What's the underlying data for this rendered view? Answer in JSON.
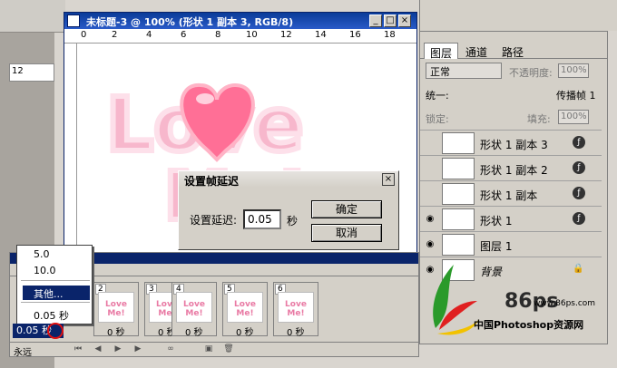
{
  "document": {
    "title": "未标题-3 @ 100% (形状 1 副本 3, RGB/8)",
    "ruler_ticks": [
      "0",
      "2",
      "4",
      "6",
      "8",
      "10",
      "12",
      "14",
      "16",
      "18"
    ],
    "left_ruler_value": "12",
    "art_text": [
      "Love",
      "Me!"
    ]
  },
  "dialog": {
    "title": "设置帧延迟",
    "label": "设置延迟:",
    "value": "0.05",
    "unit": "秒",
    "ok": "确定",
    "cancel": "取消"
  },
  "animation": {
    "frames": [
      {
        "num": "2",
        "delay": "0 秒"
      },
      {
        "num": "3",
        "delay": "0 秒"
      },
      {
        "num": "4",
        "delay": "0 秒"
      },
      {
        "num": "5",
        "delay": "0 秒"
      },
      {
        "num": "6",
        "delay": "0 秒"
      }
    ],
    "frame_thumb_text": "Love Me!",
    "loop_option": "永远",
    "selected_delay": "0.05 秒"
  },
  "delay_menu": {
    "items": [
      "5.0",
      "10.0",
      "其他...",
      "0.05 秒"
    ],
    "selected": "其他..."
  },
  "layers_panel": {
    "tabs": [
      "图层",
      "通道",
      "路径"
    ],
    "blend_mode": "正常",
    "opacity_label": "不透明度:",
    "opacity_value": "100%",
    "unify_label": "统一:",
    "propagate_label": "传播帧 1",
    "lock_label": "锁定:",
    "fill_label": "填充:",
    "fill_value": "100%",
    "layers": [
      {
        "name": "形状 1 副本 3",
        "visible": false,
        "active": true
      },
      {
        "name": "形状 1 副本 2",
        "visible": false,
        "active": false
      },
      {
        "name": "形状 1 副本",
        "visible": false,
        "active": false
      },
      {
        "name": "形状 1",
        "visible": true,
        "active": false
      },
      {
        "name": "图层 1",
        "visible": true,
        "active": false
      },
      {
        "name": "背景",
        "visible": true,
        "active": false
      }
    ]
  },
  "watermark": {
    "brand": "86ps",
    "url": "www.86ps.com",
    "name": "中国Photoshop资源网"
  },
  "colors": {
    "selection_blue": "#0a246a",
    "art_pink": "#f3a6c0",
    "heart_pink": "#ff6f96",
    "annotation_red": "#e01010"
  }
}
